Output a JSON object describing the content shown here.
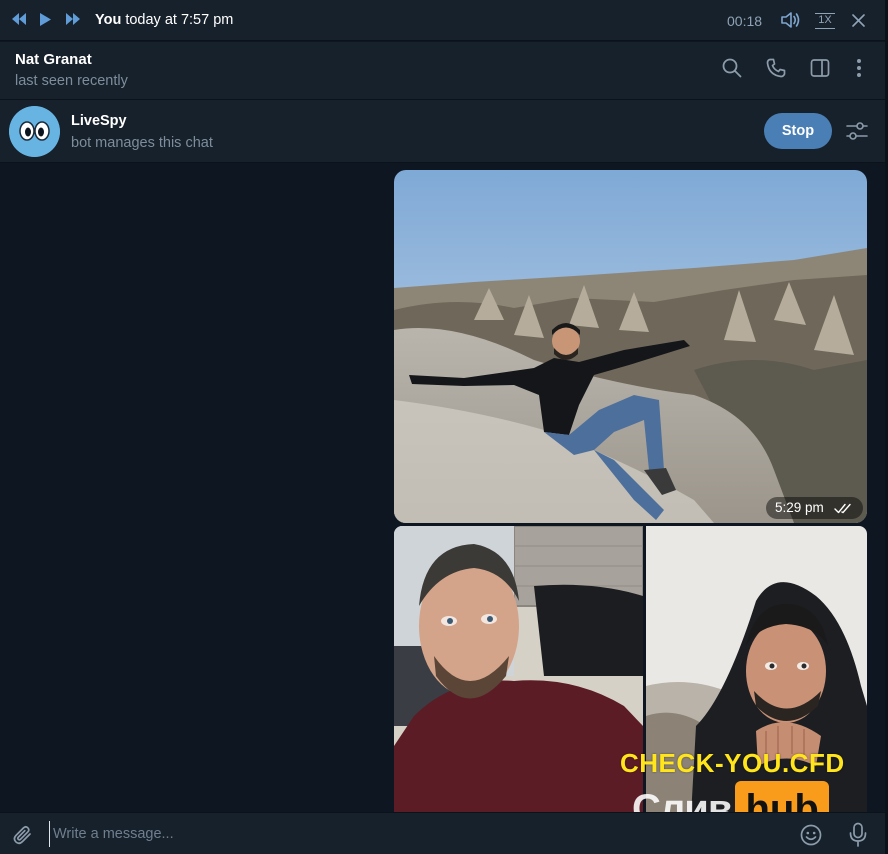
{
  "player": {
    "sender": "You",
    "when": " today at 7:57 pm",
    "duration": "00:18",
    "speed": "1X",
    "icons": [
      "rewind-icon",
      "play-icon",
      "fast-forward-icon",
      "volume-icon",
      "close-icon"
    ]
  },
  "chat": {
    "name": "Nat Granat",
    "status": "last seen recently",
    "icons": [
      "search-icon",
      "phone-icon",
      "sidebar-icon",
      "more-icon"
    ]
  },
  "bot": {
    "name": "LiveSpy",
    "subtitle": "bot manages this chat",
    "stop_label": "Stop"
  },
  "messages": {
    "photo_time": "5:29 pm",
    "status": "read"
  },
  "watermark": {
    "line1": "CHECK-YOU.CFD",
    "sliv": "Слив",
    "hub": "hub"
  },
  "composer": {
    "placeholder": "Write a message...",
    "value": ""
  },
  "colors": {
    "background": "#0e1621",
    "panel": "#17212b",
    "accent": "#4a7fb5",
    "muted_text": "#7d8d9c"
  }
}
